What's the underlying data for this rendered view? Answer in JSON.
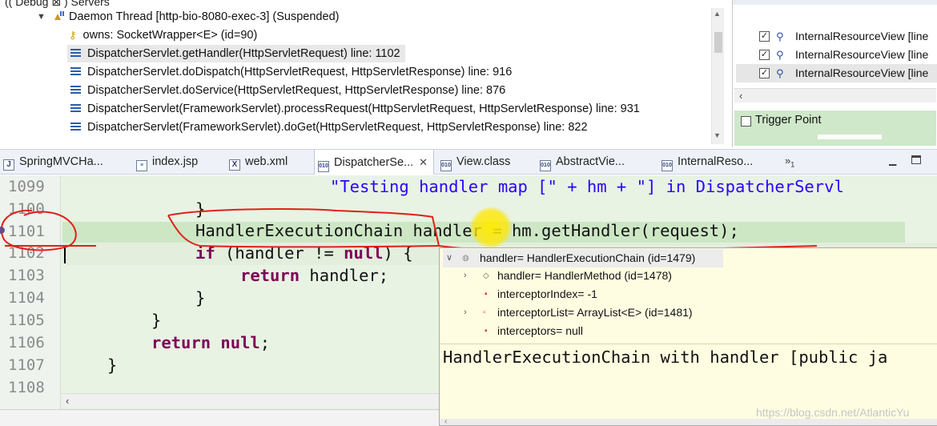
{
  "debug": {
    "cut_top": "(( Debug ⊠ ) Servers",
    "thread": {
      "label": "Daemon Thread [http-bio-8080-exec-3] (Suspended)"
    },
    "owns": {
      "label": "owns: SocketWrapper<E>  (id=90)"
    },
    "frames": [
      {
        "label": "DispatcherServlet.getHandler(HttpServletRequest) line: 1102",
        "selected": true
      },
      {
        "label": "DispatcherServlet.doDispatch(HttpServletRequest, HttpServletResponse) line: 916"
      },
      {
        "label": "DispatcherServlet.doService(HttpServletRequest, HttpServletResponse) line: 876"
      },
      {
        "label": "DispatcherServlet(FrameworkServlet).processRequest(HttpServletRequest, HttpServletResponse) line: 931"
      },
      {
        "label": "DispatcherServlet(FrameworkServlet).doGet(HttpServletRequest, HttpServletResponse) line: 822"
      }
    ]
  },
  "breakpoints": {
    "items": [
      {
        "label": "InternalResourceView [line"
      },
      {
        "label": "InternalResourceView [line"
      },
      {
        "label": "InternalResourceView [line",
        "selected": true
      }
    ],
    "trigger_point_label": "Trigger Point"
  },
  "tabs": [
    {
      "label": "SpringMVCHa...",
      "icon": "J"
    },
    {
      "label": "index.jsp",
      "icon": ""
    },
    {
      "label": "web.xml",
      "icon": "X"
    },
    {
      "label": "DispatcherSe...",
      "icon": "010",
      "active": true
    },
    {
      "label": "View.class",
      "icon": "010"
    },
    {
      "label": "AbstractVie...",
      "icon": "010"
    },
    {
      "label": "InternalReso...",
      "icon": "010"
    }
  ],
  "tab_overflow": {
    "symbol": "»",
    "count": "1"
  },
  "editor": {
    "line_numbers": [
      "1099",
      "1100",
      "1101",
      "1102",
      "1103",
      "1104",
      "1105",
      "1106",
      "1107",
      "1108"
    ],
    "lines": {
      "l1099_str": "\"Testing handler map [\" + hm + \"] in DispatcherServl",
      "l1100": "}",
      "l1101": "HandlerExecutionChain handler = hm.getHandler(request);",
      "l1102_kw": "if",
      "l1102_rest": " (handler != ",
      "l1102_null": "null",
      "l1102_end": ") {",
      "l1103_kw": "return",
      "l1103_rest": " handler;",
      "l1104": "}",
      "l1105": "}",
      "l1106_kw": "return",
      "l1106_null": "null",
      "l1106_end": ";",
      "l1107": "}"
    }
  },
  "inspect": {
    "root": {
      "label": "handler= HandlerExecutionChain  (id=1479)"
    },
    "children": [
      {
        "label": "handler= HandlerMethod  (id=1478)",
        "expandable": true
      },
      {
        "label": "interceptorIndex= -1",
        "expandable": false
      },
      {
        "label": "interceptorList= ArrayList<E>  (id=1481)",
        "expandable": true
      },
      {
        "label": "interceptors= null",
        "expandable": false
      }
    ],
    "detail": "HandlerExecutionChain with handler [public ja"
  },
  "watermark": "https://blog.csdn.net/AtlanticYu",
  "colors": {
    "editor_bg": "#e8f3e4",
    "popup_bg": "#fffde1",
    "annotation_red": "#e0201a",
    "keyword": "#7f0055",
    "string": "#2a00ff"
  }
}
